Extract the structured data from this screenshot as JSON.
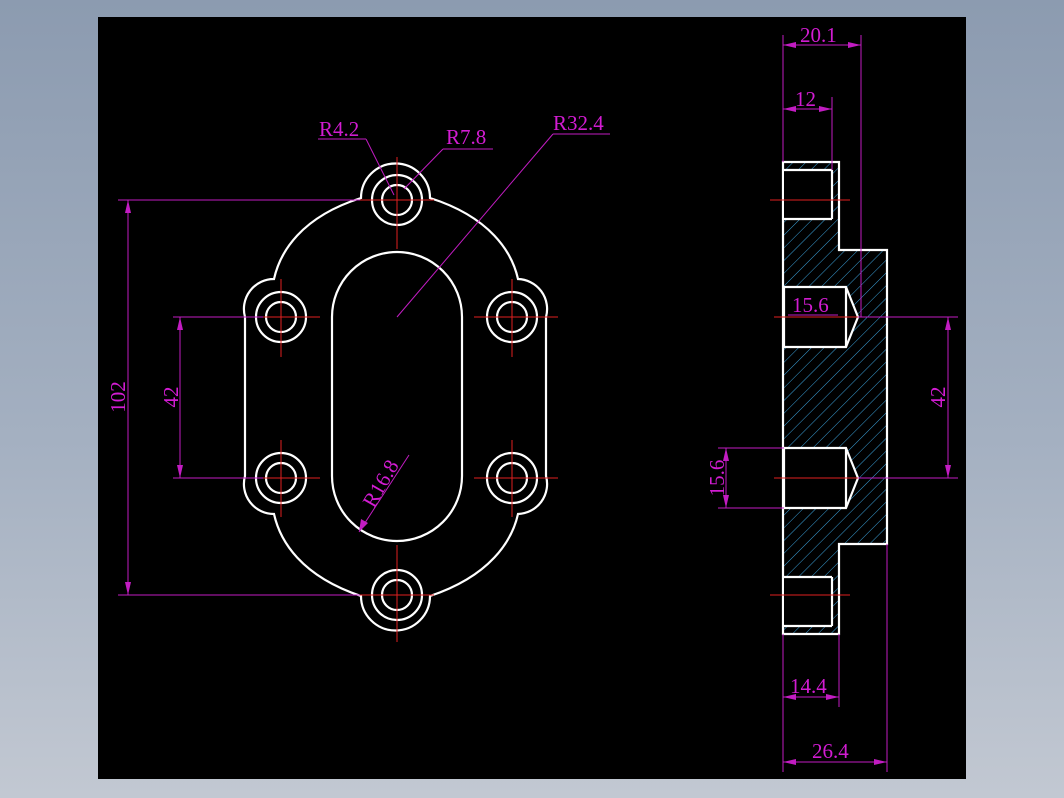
{
  "colors": {
    "background": "#000000",
    "outline": "#ffffff",
    "centerline": "#e02020",
    "dimension": "#d21cd2",
    "hatch": "#3aa0d8"
  },
  "front_view": {
    "radius_small_hole": "R4.2",
    "radius_boss": "R7.8",
    "radius_outer": "R32.4",
    "radius_slot": "R16.8",
    "overall_height": "102",
    "hole_spacing": "42"
  },
  "side_view": {
    "total_width": "20.1",
    "counterbore_depth": "12",
    "thread_dia_upper": "15.6",
    "thread_dia_lower": "15.6",
    "hole_spacing": "42",
    "flange_thickness": "14.4",
    "overall_thickness": "26.4"
  }
}
